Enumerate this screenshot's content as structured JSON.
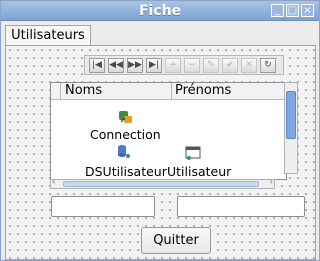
{
  "window": {
    "title": "Fiche",
    "controls": [
      "minimize-icon",
      "maximize-icon",
      "close-icon"
    ]
  },
  "tabs": [
    {
      "label": "Utilisateurs",
      "active": true
    }
  ],
  "navigator": {
    "buttons": [
      {
        "name": "first-icon",
        "enabled": true
      },
      {
        "name": "prior-icon",
        "enabled": true
      },
      {
        "name": "next-icon",
        "enabled": true
      },
      {
        "name": "last-icon",
        "enabled": true
      },
      {
        "name": "insert-icon",
        "enabled": false
      },
      {
        "name": "delete-icon",
        "enabled": false
      },
      {
        "name": "edit-icon",
        "enabled": false
      },
      {
        "name": "post-icon",
        "enabled": false
      },
      {
        "name": "cancel-icon",
        "enabled": false
      },
      {
        "name": "refresh-icon",
        "enabled": true
      }
    ]
  },
  "grid": {
    "columns": [
      "Noms",
      "Prénoms"
    ]
  },
  "components": {
    "connection": {
      "label": "Connection",
      "icon": "database-connection-icon"
    },
    "datasource": {
      "label": "DSUtilisateur",
      "icon": "datasource-icon"
    },
    "dataset": {
      "label": "Utilisateur",
      "icon": "dataset-table-icon"
    }
  },
  "fields": {
    "nom_value": "",
    "prenom_value": ""
  },
  "actions": {
    "quit_label": "Quitter"
  },
  "colors": {
    "titlebar": "#8fb0dc",
    "scroll_thumb": "#7ea8df",
    "panel_bg": "#f3f3f3"
  }
}
